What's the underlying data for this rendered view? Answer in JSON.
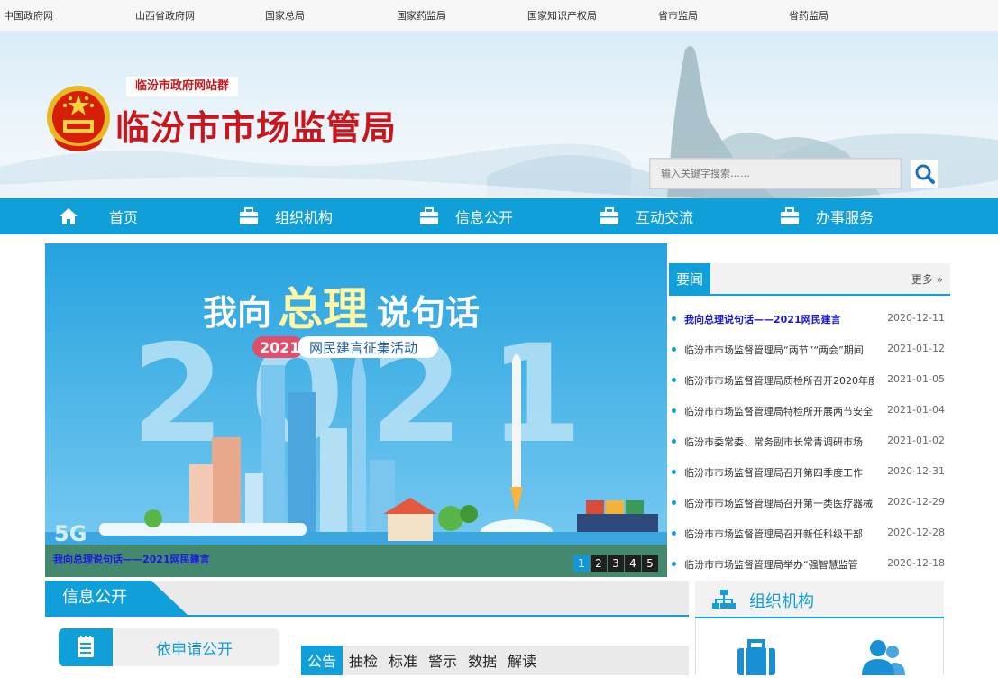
{
  "top_links": [
    "中国政府网",
    "山西省政府网",
    "国家总局",
    "国家药监局",
    "国家知识产权局",
    "省市监局",
    "省药监局"
  ],
  "header": {
    "group_tag": "临汾市政府网站群",
    "site_title": "临汾市市场监管局",
    "search_placeholder": "输入关键字搜索……"
  },
  "nav": [
    {
      "label": "首页",
      "icon": "home-icon"
    },
    {
      "label": "组织机构",
      "icon": "briefcase-icon"
    },
    {
      "label": "信息公开",
      "icon": "briefcase-icon"
    },
    {
      "label": "互动交流",
      "icon": "briefcase-icon"
    },
    {
      "label": "办事服务",
      "icon": "briefcase-icon"
    }
  ],
  "slider": {
    "headline_a": "我向",
    "headline_b": "总理",
    "headline_c": "说句话",
    "badge_year": "2021",
    "badge_text": "网民建言征集活动",
    "big_year": "2021",
    "corner_text": "5G",
    "caption": "我向总理说句话——2021网民建言",
    "pages": [
      "1",
      "2",
      "3",
      "4",
      "5"
    ],
    "active_page": 1
  },
  "news": {
    "tab": "要闻",
    "more": "更多",
    "items": [
      {
        "title": "我向总理说句话——2021网民建言",
        "date": "2020-12-11",
        "highlight": true
      },
      {
        "title": "临汾市市场监督管理局“两节”“两会”期间",
        "date": "2021-01-12"
      },
      {
        "title": "临汾市市场监督管理局质检所召开2020年度",
        "date": "2021-01-05"
      },
      {
        "title": "临汾市市场监督管理局特检所开展两节安全",
        "date": "2021-01-04"
      },
      {
        "title": "临汾市委常委、常务副市长常青调研市场",
        "date": "2021-01-02"
      },
      {
        "title": "临汾市市场监督管理局召开第四季度工作",
        "date": "2020-12-31"
      },
      {
        "title": "临汾市市场监督管理局召开第一类医疗器械",
        "date": "2020-12-29"
      },
      {
        "title": "临汾市市场监督管理局召开新任科级干部",
        "date": "2020-12-28"
      },
      {
        "title": "临汾市市场监督管理局举办“强智慧监管",
        "date": "2020-12-18"
      }
    ]
  },
  "info": {
    "title": "信息公开",
    "apply_label": "依申请公开",
    "tabs": [
      "公告",
      "抽检",
      "标准",
      "警示",
      "数据",
      "解读"
    ],
    "active_tab": 0
  },
  "org": {
    "title": "组织机构"
  },
  "colors": {
    "brand_blue": "#119fd9",
    "title_red": "#c9161d"
  }
}
